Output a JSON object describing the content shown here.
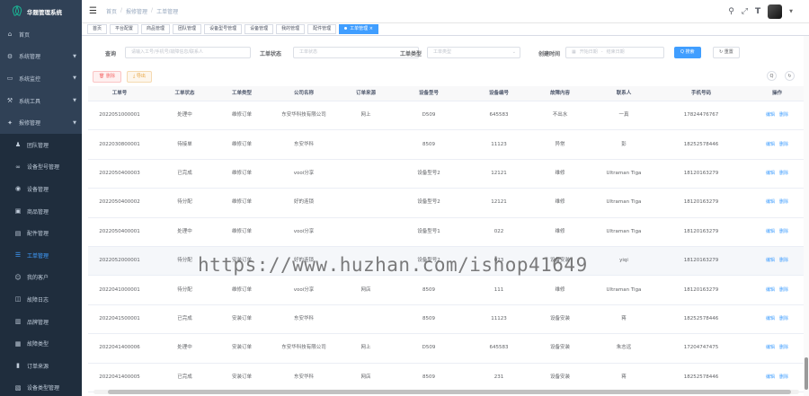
{
  "sidebar": {
    "brand": "华题管理系统",
    "items": [
      {
        "label": "首页",
        "icon": "home-icon",
        "sub": false,
        "chevron": false,
        "active": false
      },
      {
        "label": "系统管理",
        "icon": "gear-icon",
        "sub": false,
        "chevron": true,
        "active": false
      },
      {
        "label": "系统监控",
        "icon": "monitor-icon",
        "sub": false,
        "chevron": true,
        "active": false
      },
      {
        "label": "系统工具",
        "icon": "tool-icon",
        "sub": false,
        "chevron": true,
        "active": false
      },
      {
        "label": "报修管理",
        "icon": "wrench-icon",
        "sub": false,
        "chevron": true,
        "active": false
      },
      {
        "label": "团队管理",
        "icon": "user-icon",
        "sub": true,
        "chevron": false,
        "active": false
      },
      {
        "label": "设备型号管理",
        "icon": "link-icon",
        "sub": true,
        "chevron": false,
        "active": false
      },
      {
        "label": "设备管理",
        "icon": "device-icon",
        "sub": true,
        "chevron": false,
        "active": false
      },
      {
        "label": "商品管理",
        "icon": "box-icon",
        "sub": true,
        "chevron": false,
        "active": false
      },
      {
        "label": "配件管理",
        "icon": "parts-icon",
        "sub": true,
        "chevron": false,
        "active": false
      },
      {
        "label": "工单管理",
        "icon": "order-icon",
        "sub": true,
        "chevron": false,
        "active": true
      },
      {
        "label": "我的客户",
        "icon": "customer-icon",
        "sub": true,
        "chevron": false,
        "active": false
      },
      {
        "label": "故障日志",
        "icon": "log-icon",
        "sub": true,
        "chevron": false,
        "active": false
      },
      {
        "label": "品牌管理",
        "icon": "brand-icon",
        "sub": true,
        "chevron": false,
        "active": false
      },
      {
        "label": "故障类型",
        "icon": "type-icon",
        "sub": true,
        "chevron": false,
        "active": false
      },
      {
        "label": "订单来源",
        "icon": "chart-icon",
        "sub": true,
        "chevron": false,
        "active": false
      },
      {
        "label": "设备类型管理",
        "icon": "category-icon",
        "sub": true,
        "chevron": false,
        "active": false
      }
    ]
  },
  "header": {
    "breadcrumb": [
      "首页",
      "报修管理",
      "工单管理"
    ]
  },
  "tags": [
    {
      "label": "首页",
      "active": false
    },
    {
      "label": "平台配置",
      "active": false
    },
    {
      "label": "商品管理",
      "active": false
    },
    {
      "label": "团队管理",
      "active": false
    },
    {
      "label": "设备型号管理",
      "active": false
    },
    {
      "label": "设备管理",
      "active": false
    },
    {
      "label": "我的管理",
      "active": false
    },
    {
      "label": "配件管理",
      "active": false
    },
    {
      "label": "工单管理 ×",
      "active": true
    }
  ],
  "filters": {
    "query_label": "查询",
    "query_placeholder": "请输入工号/手机号/故障信息/联系人",
    "status_label": "工单状态",
    "status_placeholder": "工单状态",
    "type_label": "工单类型",
    "type_placeholder": "工单类型",
    "date_label": "创建时间",
    "date_start": "开始日期",
    "date_sep": "-",
    "date_end": "结束日期",
    "search_btn": "Q 搜索",
    "reset_btn": "↻ 重置"
  },
  "actions": {
    "delete_btn": "删除",
    "export_btn": "导出",
    "search_toggle": "Q",
    "refresh": "↻"
  },
  "table": {
    "headers": [
      "工单号",
      "工单状态",
      "工单类型",
      "公司名称",
      "订单来源",
      "设备型号",
      "设备编号",
      "故障内容",
      "联系人",
      "手机号码",
      "操作"
    ],
    "edit_label": "编辑",
    "delete_label": "删除",
    "rows": [
      [
        "2022051000001",
        "处理中",
        "维修订单",
        "东安华科技有限公司",
        "网上",
        "D509",
        "645583",
        "不出水",
        "一真",
        "17824476767"
      ],
      [
        "2022030800001",
        "待接单",
        "维修订单",
        "东安华科",
        "",
        "8509",
        "11123",
        "异常",
        "彭",
        "18252578446"
      ],
      [
        "2022050400003",
        "已完成",
        "维修订单",
        "vooi分享",
        "",
        "设备型号2",
        "12121",
        "维修",
        "Ultraman Tiga",
        "18120163279"
      ],
      [
        "2022050400002",
        "待分配",
        "维修订单",
        "好的连锁",
        "",
        "设备型号2",
        "12121",
        "维修",
        "Ultraman Tiga",
        "18120163279"
      ],
      [
        "2022050400001",
        "处理中",
        "维修订单",
        "vooi分享",
        "",
        "设备型号1",
        "022",
        "维修",
        "Ultraman Tiga",
        "18120163279"
      ],
      [
        "2022052000001",
        "待分配",
        "安装订单",
        "好的连锁",
        "",
        "设备型号2",
        "023",
        "设备安装",
        "yiqi",
        "18120163279"
      ],
      [
        "2022041000001",
        "待分配",
        "维修订单",
        "vooi分享",
        "网店",
        "8509",
        "111",
        "维修",
        "Ultraman Tiga",
        "18120163279"
      ],
      [
        "2022041500001",
        "已完成",
        "安装订单",
        "东安华科",
        "",
        "8509",
        "11123",
        "设备安装",
        "蒋",
        "18252578446"
      ],
      [
        "2022041400006",
        "处理中",
        "安装订单",
        "东安华科技有限公司",
        "网上",
        "D509",
        "645583",
        "设备安装",
        "朱志远",
        "17204747475"
      ],
      [
        "2022041400005",
        "已完成",
        "安装订单",
        "东安华科",
        "网店",
        "8509",
        "231",
        "设备安装",
        "蒋",
        "18252578446"
      ]
    ]
  },
  "watermark": "https://www.huzhan.com/ishop41649",
  "colors": {
    "sidebar_bg": "#304156",
    "accent": "#409eff",
    "danger": "#f56c6c",
    "warning": "#e6a23c"
  }
}
